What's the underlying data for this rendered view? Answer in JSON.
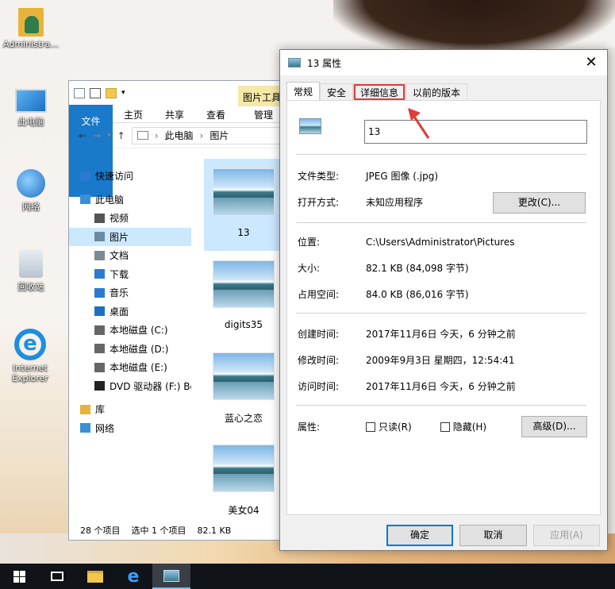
{
  "desktop": {
    "icons": [
      {
        "label": "Administra...",
        "icon": "user-folder-icon"
      },
      {
        "label": "此电脑",
        "icon": "computer-icon"
      },
      {
        "label": "网络",
        "icon": "network-icon"
      },
      {
        "label": "回收站",
        "icon": "recycle-bin-icon"
      },
      {
        "label": "Internet Explorer",
        "icon": "internet-explorer-icon"
      }
    ]
  },
  "explorer": {
    "context_tab": "图片工具",
    "ribbon_tabs": [
      "文件",
      "主页",
      "共享",
      "查看",
      "管理"
    ],
    "address": [
      "此电脑",
      "图片"
    ],
    "nav": [
      {
        "label": "快速访问",
        "icon": "star-icon",
        "sub": false,
        "selected": false
      },
      {
        "label": "此电脑",
        "icon": "computer-icon",
        "sub": false,
        "selected": false
      },
      {
        "label": "视频",
        "icon": "video-icon",
        "sub": true,
        "selected": false
      },
      {
        "label": "图片",
        "icon": "pictures-icon",
        "sub": true,
        "selected": true
      },
      {
        "label": "文档",
        "icon": "document-icon",
        "sub": true,
        "selected": false
      },
      {
        "label": "下载",
        "icon": "download-icon",
        "sub": true,
        "selected": false
      },
      {
        "label": "音乐",
        "icon": "music-icon",
        "sub": true,
        "selected": false
      },
      {
        "label": "桌面",
        "icon": "desktop-icon",
        "sub": true,
        "selected": false
      },
      {
        "label": "本地磁盘 (C:)",
        "icon": "drive-icon",
        "sub": true,
        "selected": false
      },
      {
        "label": "本地磁盘 (D:)",
        "icon": "drive-icon",
        "sub": true,
        "selected": false
      },
      {
        "label": "本地磁盘 (E:)",
        "icon": "drive-icon",
        "sub": true,
        "selected": false
      },
      {
        "label": "DVD 驱动器 (F:) Bc",
        "icon": "dvd-icon",
        "sub": true,
        "selected": false
      },
      {
        "label": "库",
        "icon": "library-icon",
        "sub": false,
        "selected": false
      },
      {
        "label": "网络",
        "icon": "network-icon",
        "sub": false,
        "selected": false
      }
    ],
    "files": [
      {
        "name": "13",
        "selected": true
      },
      {
        "name": "digits35",
        "selected": false
      },
      {
        "name": "蓝心之恋",
        "selected": false
      },
      {
        "name": "美女04",
        "selected": false
      }
    ],
    "status": {
      "count": "28 个项目",
      "selection": "选中 1 个项目",
      "size": "82.1 KB"
    }
  },
  "dialog": {
    "title": "13 属性",
    "tabs": [
      "常规",
      "安全",
      "详细信息",
      "以前的版本"
    ],
    "active_tab": "常规",
    "highlighted_tab": "详细信息",
    "file_name": "13",
    "file_type_label": "文件类型:",
    "file_type_value": "JPEG 图像 (.jpg)",
    "open_with_label": "打开方式:",
    "open_with_value": "未知应用程序",
    "change_button": "更改(C)...",
    "location_label": "位置:",
    "location_value": "C:\\Users\\Administrator\\Pictures",
    "size_label": "大小:",
    "size_value": "82.1 KB (84,098 字节)",
    "size_on_disk_label": "占用空间:",
    "size_on_disk_value": "84.0 KB (86,016 字节)",
    "created_label": "创建时间:",
    "created_value": "2017年11月6日 今天，6 分钟之前",
    "modified_label": "修改时间:",
    "modified_value": "2009年9月3日 星期四，12:54:41",
    "accessed_label": "访问时间:",
    "accessed_value": "2017年11月6日 今天，6 分钟之前",
    "attributes_label": "属性:",
    "readonly_label": "只读(R)",
    "hidden_label": "隐藏(H)",
    "advanced_button": "高级(D)...",
    "ok_button": "确定",
    "cancel_button": "取消",
    "apply_button": "应用(A)"
  },
  "colors": {
    "accent": "#1979ca",
    "selection": "#cce8ff",
    "highlight_red": "#e23b3b"
  }
}
